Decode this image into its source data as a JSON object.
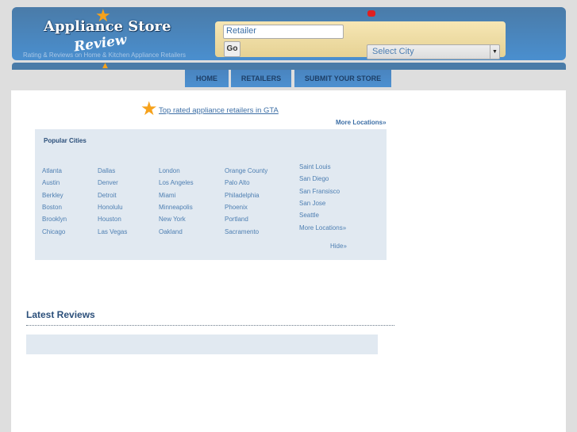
{
  "header": {
    "logo_title": "Appliance Store",
    "logo_subtitle": "Review",
    "tagline": "Rating & Reviews on Home & Kitchen Appliance Retailers"
  },
  "search": {
    "retailer_value": "Retailer",
    "go_label": "Go",
    "city_select": "Select City"
  },
  "nav": [
    {
      "label": "HOME"
    },
    {
      "label": "RETAILERS"
    },
    {
      "label": "SUBMIT YOUR STORE"
    }
  ],
  "main": {
    "gta_link": "Top rated appliance retailers in GTA",
    "more_locations": "More Locations»",
    "popular_title": "Popular Cities",
    "columns": [
      [
        "Atlanta",
        "Austin",
        "Berkley",
        "Boston",
        "Brooklyn",
        "Chicago"
      ],
      [
        "Dallas",
        "Denver",
        "Detroit",
        "Honolulu",
        "Houston",
        "Las Vegas"
      ],
      [
        "London",
        "Los Angeles",
        "Miami",
        "Minneapolis",
        "New York",
        "Oakland"
      ],
      [
        "Orange County",
        "Palo Alto",
        "Philadelphia",
        "Phoenix",
        "Portland",
        "Sacramento"
      ],
      [
        "Saint Louis",
        "San Diego",
        "San Fransisco",
        "San Jose",
        "Seattle",
        "More Locations»"
      ]
    ],
    "hide": "Hide»",
    "latest_reviews": "Latest Reviews"
  },
  "colors": {
    "header_blue": "#4a8fcf",
    "link": "#3d6fa6",
    "panel": "#e1e9f1",
    "star": "#f6a21c"
  }
}
